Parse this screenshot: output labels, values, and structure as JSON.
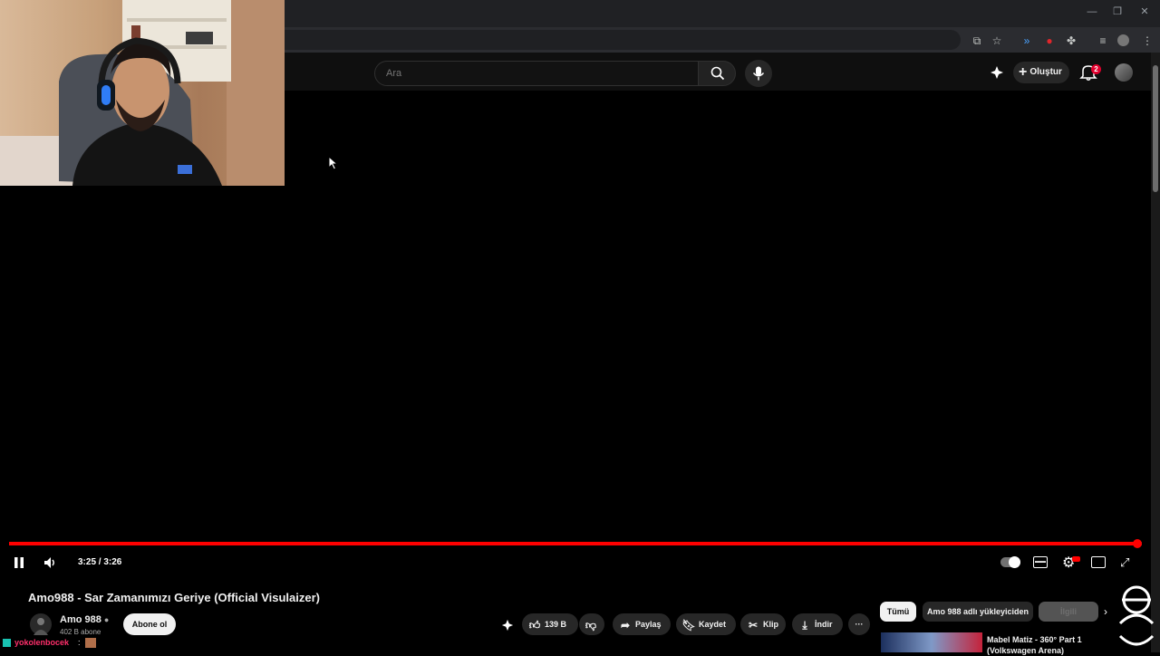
{
  "search": {
    "placeholder": "Ara"
  },
  "masthead": {
    "create_label": "Oluştur",
    "notification_count": "2"
  },
  "player": {
    "time": "3:25 / 3:26",
    "progress": 0.995
  },
  "video": {
    "title": "Amo988 - Sar Zamanımızı Geriye (Official Visulaizer)",
    "channel": "Amo 988",
    "subscribers": "402 B abone",
    "subscribe_label": "Abone ol",
    "likes": "139 B",
    "share_label": "Paylaş",
    "save_label": "Kaydet",
    "clip_label": "Klip",
    "download_label": "İndir"
  },
  "chips": [
    "Tümü",
    "Amo 988 adlı yükleyiciden",
    "İlgili"
  ],
  "related": {
    "title": "Mabel Matiz - 360° Part 1 (Volkswagen Arena)"
  },
  "chat": {
    "user": "yokolenbocek",
    "separator": ":"
  },
  "colors": {
    "accent": "#ff0000",
    "background": "#0f0f0f"
  }
}
